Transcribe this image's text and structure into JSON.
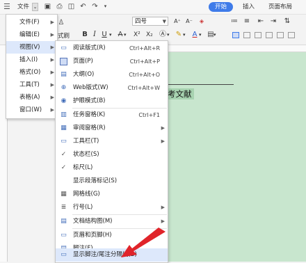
{
  "topbar": {
    "menu_icon": "hamburger-icon",
    "file_label": "文件",
    "tabs": [
      {
        "label": "开始",
        "active": true
      },
      {
        "label": "插入",
        "active": false
      },
      {
        "label": "页面布局",
        "active": false
      }
    ]
  },
  "ribbon": {
    "font_size_value": "四号",
    "style_fragment": "式刷",
    "bold": "B",
    "italic": "I",
    "underline": "U",
    "superscript": "X²",
    "subscript": "X₂"
  },
  "main_menu": {
    "items": [
      {
        "label": "文件(F)",
        "has_submenu": true
      },
      {
        "label": "编辑(E)",
        "has_submenu": true
      },
      {
        "label": "视图(V)",
        "has_submenu": true,
        "active": true
      },
      {
        "label": "插入(I)",
        "has_submenu": true
      },
      {
        "label": "格式(O)",
        "has_submenu": true
      },
      {
        "label": "工具(T)",
        "has_submenu": true
      },
      {
        "label": "表格(A)",
        "has_submenu": true
      },
      {
        "label": "窗口(W)",
        "has_submenu": true
      }
    ]
  },
  "view_menu": {
    "items": [
      {
        "label": "阅读版式(R)",
        "shortcut": "Ctrl+Alt+R",
        "icon": "reading-layout-icon"
      },
      {
        "label": "页面(P)",
        "shortcut": "Ctrl+Alt+P",
        "icon": "page-view-icon"
      },
      {
        "label": "大纲(O)",
        "shortcut": "Ctrl+Alt+O",
        "icon": "outline-icon"
      },
      {
        "label": "Web版式(W)",
        "shortcut": "Ctrl+Alt+W",
        "icon": "web-layout-icon"
      },
      {
        "label": "护眼模式(B)",
        "shortcut": "",
        "icon": "eye-protection-icon"
      },
      {
        "label": "任务窗格(K)",
        "shortcut": "Ctrl+F1",
        "icon": "task-pane-icon"
      },
      {
        "label": "审阅窗格(R)",
        "shortcut": "",
        "icon": "review-pane-icon",
        "has_submenu": true
      },
      {
        "label": "工具栏(T)",
        "shortcut": "",
        "icon": "toolbar-icon",
        "has_submenu": true
      },
      {
        "label": "状态栏(S)",
        "shortcut": "",
        "icon": "checkmark-icon"
      },
      {
        "label": "标尺(L)",
        "shortcut": "",
        "icon": "checkmark-icon"
      },
      {
        "label": "显示段落标记(S)",
        "shortcut": "",
        "icon": ""
      },
      {
        "label": "网格线(G)",
        "shortcut": "",
        "icon": "gridlines-icon"
      },
      {
        "label": "行号(L)",
        "shortcut": "",
        "icon": "line-number-icon",
        "has_submenu": true
      },
      {
        "label": "文档结构图(M)",
        "shortcut": "",
        "icon": "document-map-icon",
        "has_submenu": true
      },
      {
        "label": "页眉和页脚(H)",
        "shortcut": "",
        "icon": "header-footer-icon"
      },
      {
        "label": "脚注(F)",
        "shortcut": "",
        "icon": "footnote-icon"
      },
      {
        "label": "显示脚注/尾注分隔线(B)",
        "shortcut": "",
        "icon": "footnote-separator-icon",
        "hover": true
      }
    ]
  },
  "document": {
    "visible_text": "考文献"
  },
  "colors": {
    "accent": "#3f7be9",
    "eye_protection_bg": "#c8e6ce",
    "arrow": "#e0242a"
  }
}
